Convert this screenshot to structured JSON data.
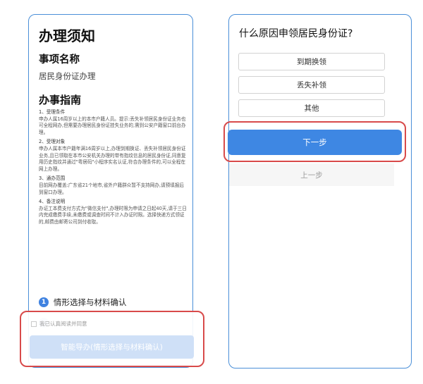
{
  "left_panel": {
    "title": "办理须知",
    "item_name_label": "事项名称",
    "item_name_value": "居民身份证办理",
    "guide_heading": "办事指南",
    "guide_sections": [
      {
        "title": "1、受理条件",
        "text": "申办人属16周岁以上的本市户籍人员。提示:丢失补领居民身份证业务也可全程网办,但需要办理居民身份证挂失业务的,需到公安户籍窗口前台办理。"
      },
      {
        "title": "2、受理对象",
        "text": "申办人属本市户籍年满16周岁以上,办理到期换证、丢失补领居民身份证业务,且已领取在本市公安机关办理的带有指纹信息的居民身份证,同意复用历史指纹并通过\"粤居码\"小程序实名认证,符合办理条件的,可以全程在网上办理。"
      },
      {
        "title": "3、通办范围",
        "text": "目前网办覆盖:广东省21个地市,省外户籍群众暂不支持网办,请预填报后到窗口办理。"
      },
      {
        "title": "4、备注说明",
        "text": "办证工本费支付方式为\"微信支付\",办理时限为申请之日起40天,请于三日内完成缴费手续,未缴费或调查时间不计入办证时限。选择快递方式领证的,邮费由邮寄公司到付收取。"
      }
    ],
    "step1_number": "1",
    "step1_label": "情形选择与材料确认",
    "agree_text": "我已认真阅读并同意",
    "smart_button": "智能导办(情形选择与材料确认)"
  },
  "right_panel": {
    "question": "什么原因申领居民身份证?",
    "options": [
      "到期换领",
      "丢失补领",
      "其他"
    ],
    "next_button": "下一步",
    "prev_button": "上一步"
  },
  "colors": {
    "panel_border": "#4a8fd8",
    "highlight_red": "#d84a4a",
    "primary_blue": "#3e87e3",
    "disabled_blue": "#cfe0f7"
  }
}
